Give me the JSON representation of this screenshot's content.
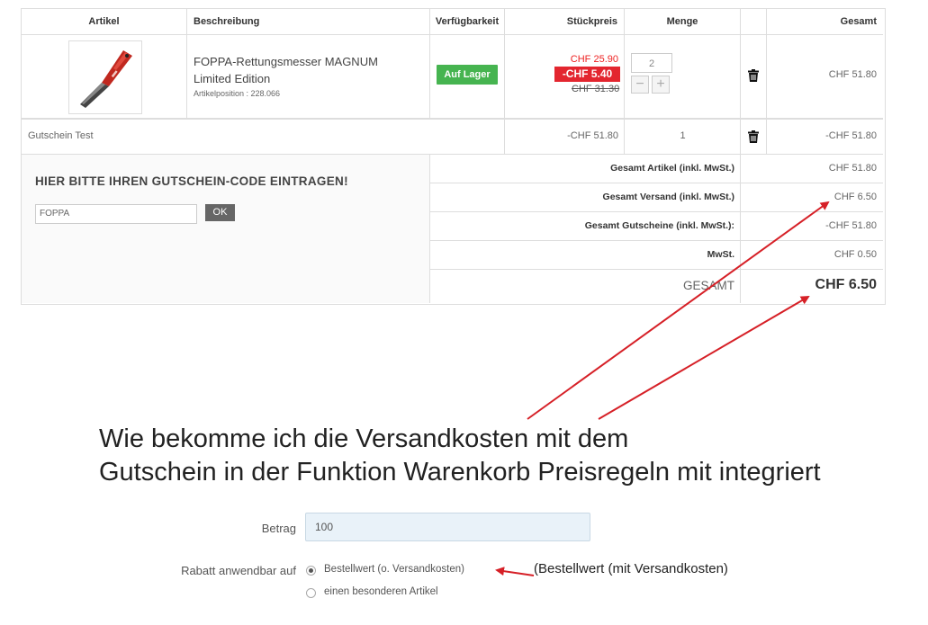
{
  "cart": {
    "headers": {
      "artikel": "Artikel",
      "beschreibung": "Beschreibung",
      "verfuegbarkeit": "Verfügbarkeit",
      "stueckpreis": "Stückpreis",
      "menge": "Menge",
      "gesamt": "Gesamt"
    },
    "item": {
      "title": "FOPPA-Rettungsmesser MAGNUM Limited Edition",
      "position": "Artikelposition : 228.066",
      "stock": "Auf Lager",
      "price_new": "CHF 25.90",
      "discount": "-CHF 5.40",
      "price_old": "CHF 31.30",
      "quantity": "2",
      "qty_minus": "−",
      "qty_plus": "+",
      "total": "CHF 51.80"
    },
    "voucher": {
      "name": "Gutschein Test",
      "price": "-CHF 51.80",
      "quantity": "1",
      "total": "-CHF 51.80"
    },
    "coupon": {
      "heading": "HIER BITTE IHREN GUTSCHEIN-CODE EINTRAGEN!",
      "value": "FOPPA",
      "ok_label": "OK"
    },
    "summary": [
      {
        "label": "Gesamt Artikel (inkl. MwSt.)",
        "value": "CHF 51.80"
      },
      {
        "label": "Gesamt Versand (inkl. MwSt.)",
        "value": "CHF 6.50"
      },
      {
        "label": "Gesamt Gutscheine (inkl. MwSt.):",
        "value": "-CHF 51.80"
      },
      {
        "label": "MwSt.",
        "value": "CHF 0.50"
      }
    ],
    "grand_total": {
      "label": "GESAMT",
      "value": "CHF 6.50"
    }
  },
  "question": {
    "line1": "Wie bekomme ich die Versandkosten mit dem",
    "line2": "Gutschein in der Funktion Warenkorb Preisregeln mit integriert"
  },
  "form": {
    "betrag_label": "Betrag",
    "betrag_value": "100",
    "rabatt_label": "Rabatt anwendbar auf",
    "option1": "Bestellwert (o. Versandkosten)",
    "option2": "einen besonderen Artikel",
    "note": "(Bestellwert (mit Versandkosten)"
  },
  "colors": {
    "stock_green": "#46b450",
    "discount_red": "#e3262f",
    "annotation_red": "#d62027",
    "input_blue": "#e9f2f9"
  }
}
